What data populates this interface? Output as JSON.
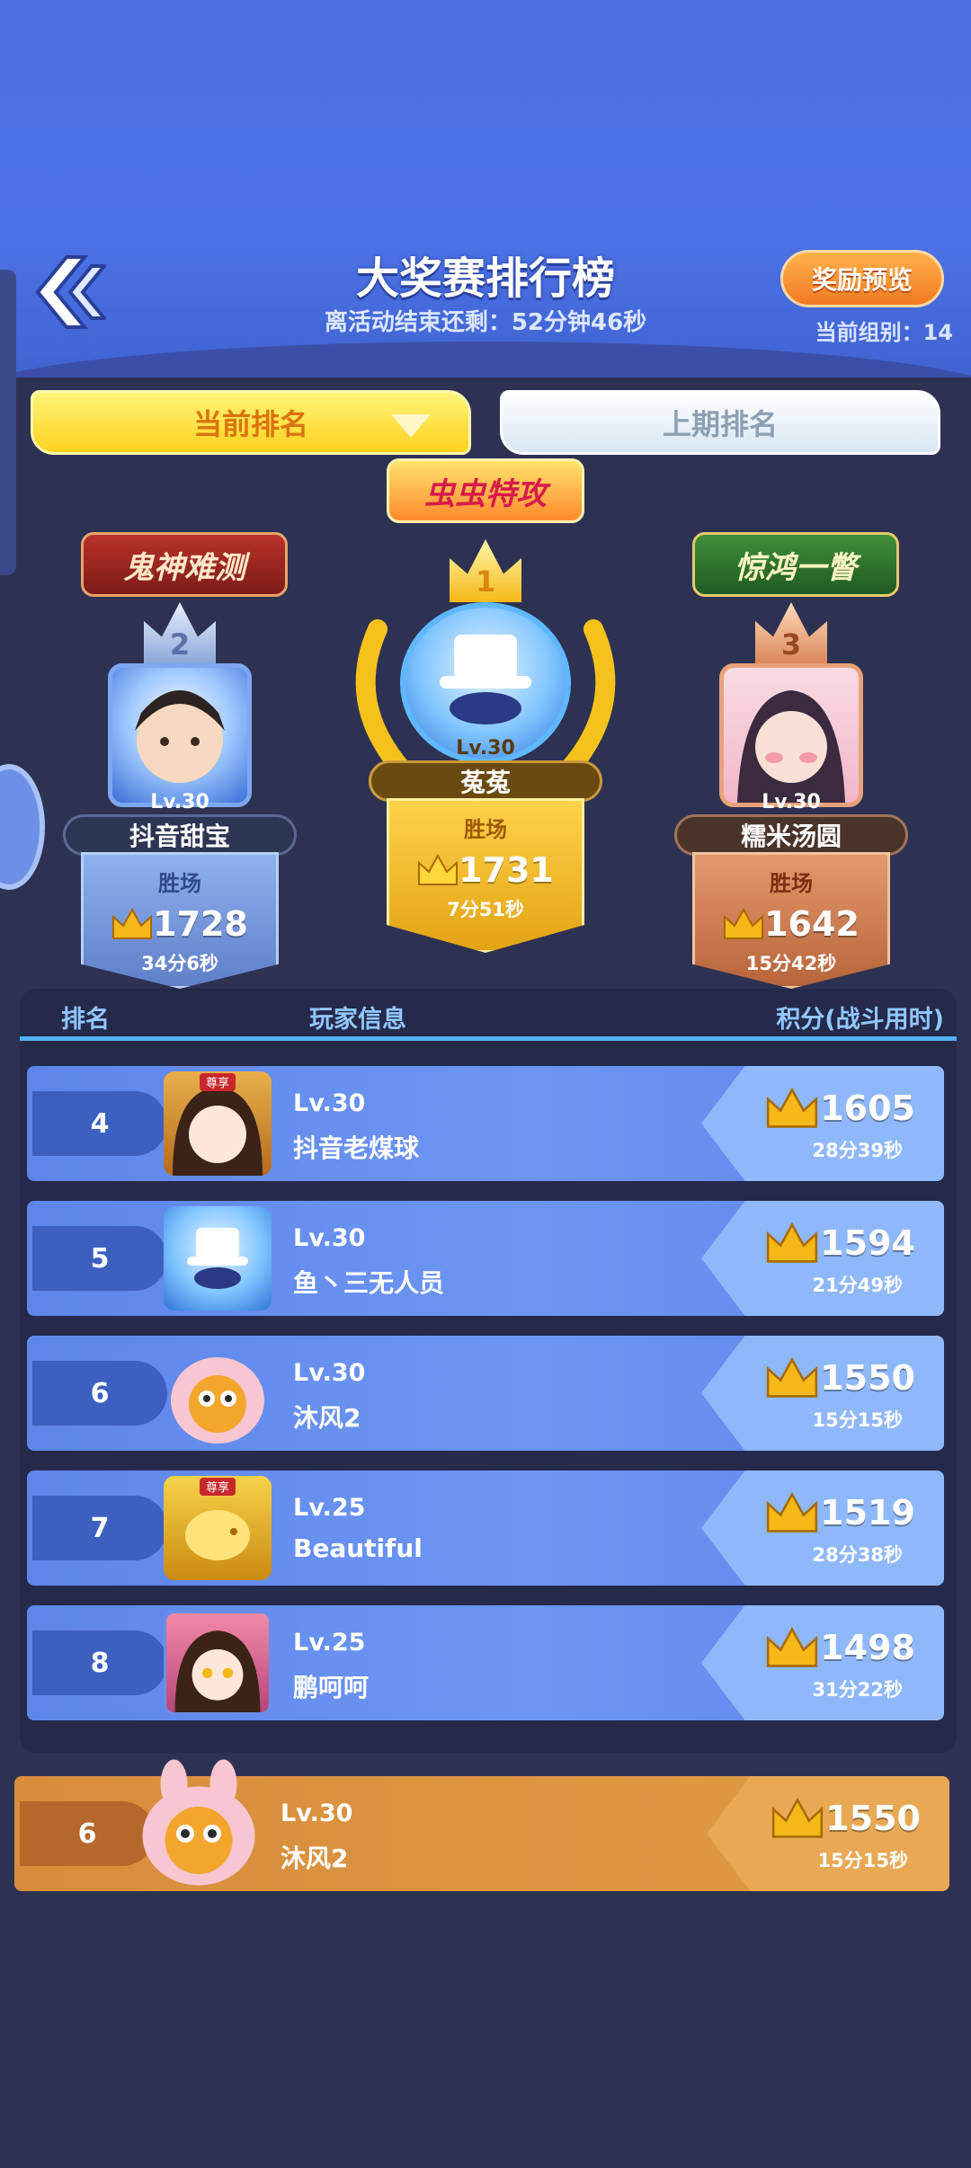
{
  "header": {
    "title": "大奖赛排行榜",
    "countdown": "离活动结束还剩：52分钟46秒",
    "reward_button": "奖励预览",
    "group": "当前组别：14"
  },
  "tabs": {
    "current": "当前排名",
    "previous": "上期排名"
  },
  "podium": [
    {
      "place": "2",
      "badge": "鬼神难测",
      "level": "Lv.30",
      "name": "抖音甜宝",
      "win_label": "胜场",
      "score": "1728",
      "time": "34分6秒"
    },
    {
      "place": "1",
      "badge": "虫虫特攻",
      "level": "Lv.30",
      "name": "菟菟",
      "win_label": "胜场",
      "score": "1731",
      "time": "7分51秒"
    },
    {
      "place": "3",
      "badge": "惊鸿一瞥",
      "level": "Lv.30",
      "name": "糯米汤圆",
      "win_label": "胜场",
      "score": "1642",
      "time": "15分42秒"
    }
  ],
  "table": {
    "headers": {
      "rank": "排名",
      "player": "玩家信息",
      "score": "积分(战斗用时)"
    },
    "rows": [
      {
        "rank": "4",
        "level": "Lv.30",
        "name": "抖音老煤球",
        "score": "1605",
        "time": "28分39秒",
        "tag": "尊享"
      },
      {
        "rank": "5",
        "level": "Lv.30",
        "name": "鱼丶三无人员",
        "score": "1594",
        "time": "21分49秒",
        "tag": ""
      },
      {
        "rank": "6",
        "level": "Lv.30",
        "name": "沐风2",
        "score": "1550",
        "time": "15分15秒",
        "tag": ""
      },
      {
        "rank": "7",
        "level": "Lv.25",
        "name": "Beautiful",
        "score": "1519",
        "time": "28分38秒",
        "tag": "尊享"
      },
      {
        "rank": "8",
        "level": "Lv.25",
        "name": "鹏呵呵",
        "score": "1498",
        "time": "31分22秒",
        "tag": ""
      }
    ]
  },
  "me": {
    "rank": "6",
    "level": "Lv.30",
    "name": "沐风2",
    "score": "1550",
    "time": "15分15秒"
  },
  "colors": {
    "accent": "#ffd21e",
    "row": "#6d96f2",
    "me_row": "#e09b46",
    "gold": "#f5b819"
  }
}
